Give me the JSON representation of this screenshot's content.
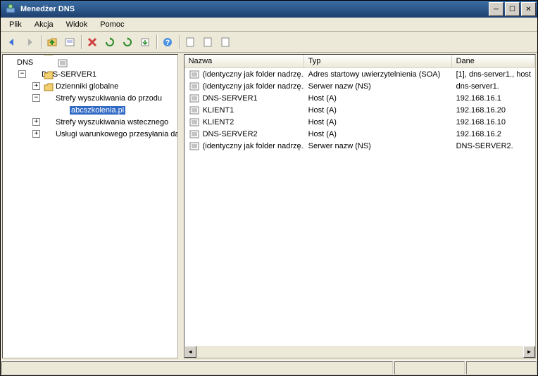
{
  "window": {
    "title": "Menedżer DNS"
  },
  "menu": {
    "file": "Plik",
    "action": "Akcja",
    "view": "Widok",
    "help": "Pomoc"
  },
  "tree": {
    "root": "DNS",
    "server": "DNS-SERVER1",
    "globalLogs": "Dzienniki globalne",
    "fwdZones": "Strefy wyszukiwania do przodu",
    "zone": "abcszkolenia.pl",
    "revZones": "Strefy wyszukiwania wstecznego",
    "condFwd": "Usługi warunkowego przesyłania dalej"
  },
  "columns": {
    "name": "Nazwa",
    "type": "Typ",
    "data": "Dane"
  },
  "records": [
    {
      "name": "(identyczny jak folder nadrzę...",
      "type": "Adres startowy uwierzytelnienia (SOA)",
      "data": "[1], dns-server1., host"
    },
    {
      "name": "(identyczny jak folder nadrzę...",
      "type": "Serwer nazw (NS)",
      "data": "dns-server1."
    },
    {
      "name": "DNS-SERVER1",
      "type": "Host (A)",
      "data": "192.168.16.1"
    },
    {
      "name": "KLIENT1",
      "type": "Host (A)",
      "data": "192.168.16.20"
    },
    {
      "name": "KLIENT2",
      "type": "Host (A)",
      "data": "192.168.16.10"
    },
    {
      "name": "DNS-SERVER2",
      "type": "Host (A)",
      "data": "192.168.16.2"
    },
    {
      "name": "(identyczny jak folder nadrzę...",
      "type": "Serwer nazw (NS)",
      "data": "DNS-SERVER2."
    }
  ]
}
